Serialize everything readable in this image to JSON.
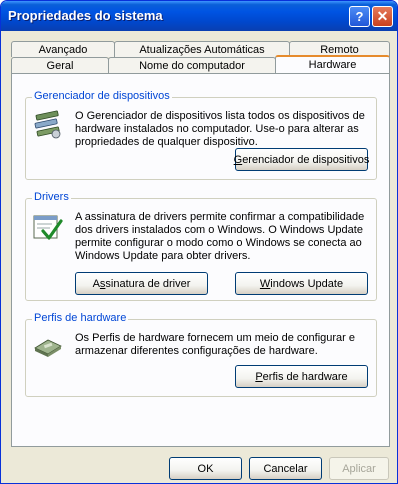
{
  "window": {
    "title": "Propriedades do sistema"
  },
  "titlebar_buttons": {
    "help": "?",
    "close": "✕"
  },
  "tabs": {
    "row1": [
      "Avançado",
      "Atualizações Automáticas",
      "Remoto"
    ],
    "row2": [
      "Geral",
      "Nome do computador",
      "Hardware"
    ],
    "active": "Hardware"
  },
  "device_manager": {
    "label": "Gerenciador de dispositivos",
    "description": "O Gerenciador de dispositivos lista todos os dispositivos de hardware instalados no computador. Use-o para alterar as propriedades de qualquer dispositivo.",
    "button": {
      "mnemonic": "G",
      "rest": "erenciador de dispositivos"
    },
    "icon": "device-manager-icon"
  },
  "drivers": {
    "label": "Drivers",
    "description": "A assinatura de drivers permite confirmar a compatibilidade dos drivers instalados com o Windows. O Windows Update permite configurar o modo como o Windows se conecta ao Windows Update para obter drivers.",
    "signing_button": {
      "pre": "A",
      "mnemonic": "s",
      "rest": "sinatura de driver"
    },
    "update_button": {
      "mnemonic": "W",
      "rest": "indows Update"
    },
    "icon": "driver-signing-icon"
  },
  "hardware_profiles": {
    "label": "Perfis de hardware",
    "description": "Os Perfis de hardware fornecem um meio de configurar e armazenar diferentes configurações de hardware.",
    "button": {
      "mnemonic": "P",
      "rest": "erfis de hardware"
    },
    "icon": "hardware-profiles-icon"
  },
  "footer": {
    "ok": "OK",
    "cancel": "Cancelar",
    "apply": "Aplicar"
  }
}
